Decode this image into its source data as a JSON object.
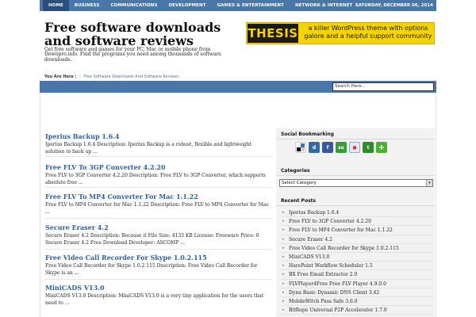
{
  "nav": {
    "items": [
      "HOME",
      "BUSINESS",
      "COMMUNICATIONS",
      "DEVELOPMENT",
      "GAMES & ENTERTAINMENT",
      "NETWORK & INTERNET"
    ],
    "date": "SATURDAY, DECEMBER 06, 2014"
  },
  "header": {
    "title": "Free software downloads and software reviews",
    "description": "Get free software and games for your PC, Mac or mobile phone from Downpro.info. Find the programs you need among thousands of software downloads."
  },
  "banner": {
    "brand": "THESIS",
    "text": "a killer WordPress theme with options galore and a helpful support community"
  },
  "breadcrumb": {
    "label": "You Are Here :",
    "separator": "|",
    "link": "Free Software Downloads And Software Reviews"
  },
  "search": {
    "placeholder": "Search Here..."
  },
  "posts": [
    {
      "title": "Iperius Backup 1.6.4",
      "excerpt": "Iperius Backup 1.6.4 Description: Iperius Backup is a robust, flexible and lightweight solution to back up ..."
    },
    {
      "title": "Free FLV To 3GP Converter 4.2.20",
      "excerpt": "Free FLV to 3GP Converter 4.2.20 Description: Free FLV to 3GP Converter, which supports absolute free ..."
    },
    {
      "title": "Free FLV To MP4 Converter For Mac 1.1.22",
      "excerpt": "Free FLV to MP4 Converter for Mac 1.1.22 Description: Free FLV to MP4 Converter for Mac ..."
    },
    {
      "title": "Secure Eraser 4.2",
      "excerpt": "Secure Eraser 4.2 Description: Because it File Size: 4133 KB License: Freeware Price: 0 Secure Eraser 4.2 Free Download Developer: ASCOMP ..."
    },
    {
      "title": "Free Video Call Recorder For Skype 1.0.2.115",
      "excerpt": "Free Video Call Recorder for Skype 1.0.2.115 Description: Free Video Call Recorder for Skype is an ..."
    },
    {
      "title": "MiniCADS V13.0",
      "excerpt": "MiniCADS V13.0 Description: MiniCADS V13.0 is a very tiny application for the users that need to ..."
    }
  ],
  "sidebar": {
    "social_heading": "Social Bookmarking",
    "social_icons": [
      {
        "name": "delicious",
        "color": "#3274d1"
      },
      {
        "name": "digg",
        "color": "#356aa0"
      },
      {
        "name": "facebook",
        "color": "#3b5998"
      },
      {
        "name": "stumbleupon",
        "color": "#3a9a3a"
      },
      {
        "name": "reddit",
        "color": "#7f9fc7"
      },
      {
        "name": "technorati",
        "color": "#2e8b2e"
      },
      {
        "name": "share",
        "color": "#4caf2f"
      }
    ],
    "categories_heading": "Categories",
    "category_select": "Select Category",
    "recent_heading": "Recent Posts",
    "recent_posts": [
      "Iperius Backup 1.6.4",
      "Free FLV to 3GP Converter 4.2.20",
      "Free FLV to MP4 Converter for Mac 1.1.22",
      "Secure Eraser 4.2",
      "Free Video Call Recorder for Skype 1.0.2.115",
      "MiniCADS V13.0",
      "HarePoint Workflow Scheduler 1.5",
      "BX Free Email Extractor 2.0",
      "FLVPlayer4Free Free FLV Player 4.9.0.0",
      "Dynu Basic Dynamic DNS Client 3.42",
      "MobileWitch Pass Safe 3.6.0",
      "BitRope Universal P2P Accelerator 1.7.0"
    ]
  },
  "colors": {
    "nav": "#4b77a8",
    "link": "#2e5f9e",
    "banner": "#f5d300"
  }
}
